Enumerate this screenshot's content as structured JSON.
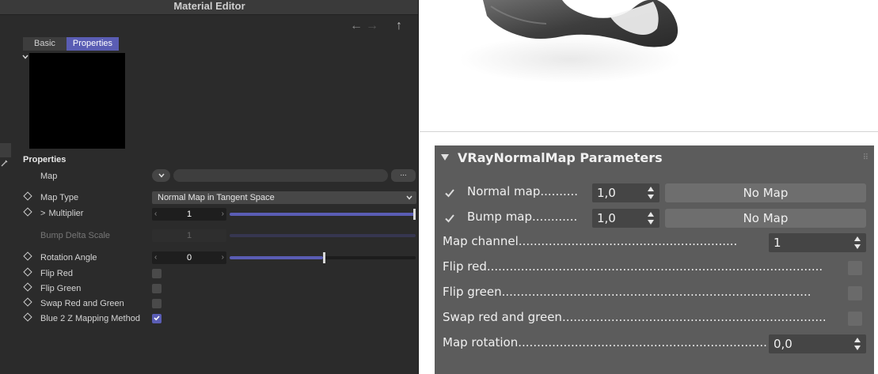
{
  "editor": {
    "title": "Material Editor",
    "nav": {
      "back": "←",
      "forward": "→",
      "up": "↑"
    },
    "tabs": [
      {
        "label": "Basic"
      },
      {
        "label": "Properties"
      }
    ],
    "section_title": "Properties",
    "map": {
      "label": "Map",
      "dropdown_glyph": "⌄",
      "browse_label": "..."
    },
    "map_type": {
      "label": "Map Type",
      "value": "Normal Map in Tangent Space"
    },
    "multiplier": {
      "label": "Multiplier",
      "expand_glyph": ">",
      "value": "1",
      "fill": 1.0
    },
    "bump_delta": {
      "label": "Bump Delta Scale",
      "value": "1"
    },
    "rotation": {
      "label": "Rotation Angle",
      "value": "0",
      "fill": 0.5
    },
    "flags": [
      {
        "label": "Flip Red",
        "checked": false
      },
      {
        "label": "Flip Green",
        "checked": false
      },
      {
        "label": "Swap Red and Green",
        "checked": false
      },
      {
        "label": "Blue 2 Z Mapping Method",
        "checked": true
      }
    ],
    "colors": {
      "accent": "#5a5db4",
      "panel": "#2b2b2b"
    }
  },
  "vray": {
    "title": "VRayNormalMap Parameters",
    "normal_map": {
      "label": "Normal map..........",
      "value": "1,0",
      "button": "No Map",
      "checked": true
    },
    "bump_map": {
      "label": "Bump map............",
      "value": "1,0",
      "button": "No Map",
      "checked": true
    },
    "map_channel": {
      "label": "Map channel..........................................................",
      "value": "1"
    },
    "flip_red": {
      "label": "Flip red.........................................................................................",
      "checked": false
    },
    "flip_green": {
      "label": "Flip green..................................................................................",
      "checked": false
    },
    "swap_rg": {
      "label": "Swap red and green......................................................................",
      "checked": false
    },
    "map_rotation": {
      "label": "Map rotation.....................................................................",
      "value": "0,0"
    },
    "colors": {
      "panel": "#5c5c5c",
      "field": "#454545"
    }
  }
}
